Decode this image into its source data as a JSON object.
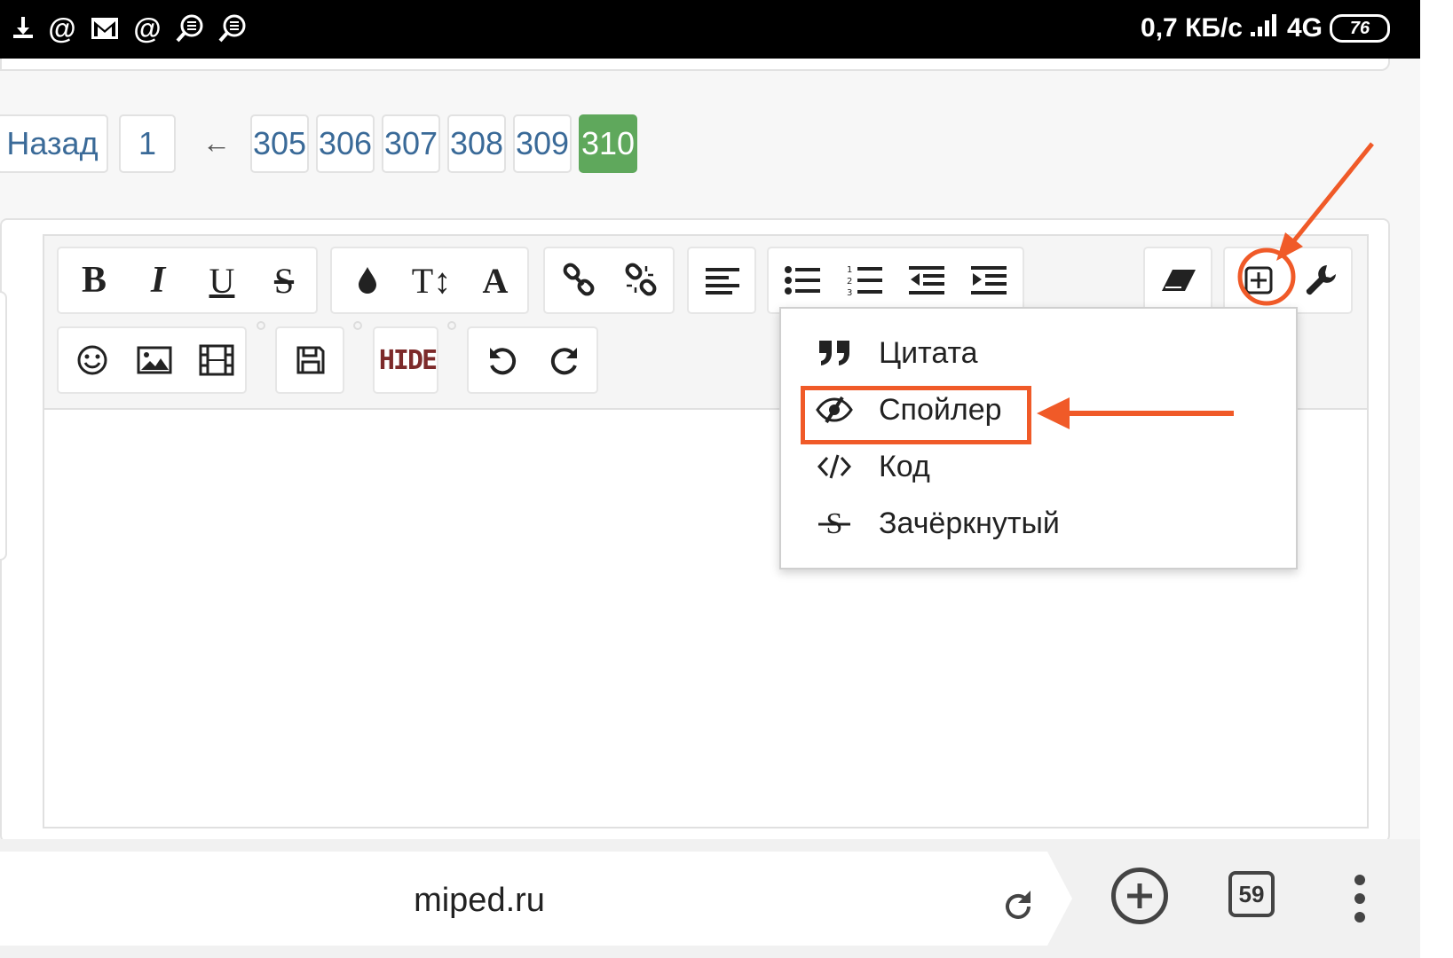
{
  "status_bar": {
    "left_icons": [
      "download-icon",
      "at-icon",
      "gmail-icon",
      "at-icon",
      "vpn-icon",
      "vpn-icon"
    ],
    "speed": "0,7 КБ/с",
    "network": "4G",
    "battery": "76"
  },
  "pagination": {
    "back_label": "Назад",
    "first_page": "1",
    "ellipsis_arrow": "←",
    "pages": [
      "305",
      "306",
      "307",
      "308",
      "309",
      "310"
    ],
    "current_page": "310"
  },
  "toolbar": {
    "row1": {
      "bold": "B",
      "italic": "I",
      "underline": "U",
      "strike": "S",
      "font_size": "T↕",
      "font": "A"
    },
    "row2": {
      "hide": "HIDE"
    }
  },
  "insert_menu": {
    "items": [
      {
        "label": "Цитата",
        "icon": "quote-icon"
      },
      {
        "label": "Спойлер",
        "icon": "eye-slash-icon"
      },
      {
        "label": "Код",
        "icon": "code-icon"
      },
      {
        "label": "Зачёркнутый",
        "icon": "strikethrough-icon"
      }
    ]
  },
  "browser": {
    "url": "miped.ru",
    "tab_count": "59"
  },
  "colors": {
    "active_page": "#5fa85c",
    "annotation": "#f05a28",
    "link": "#3a6a98"
  }
}
